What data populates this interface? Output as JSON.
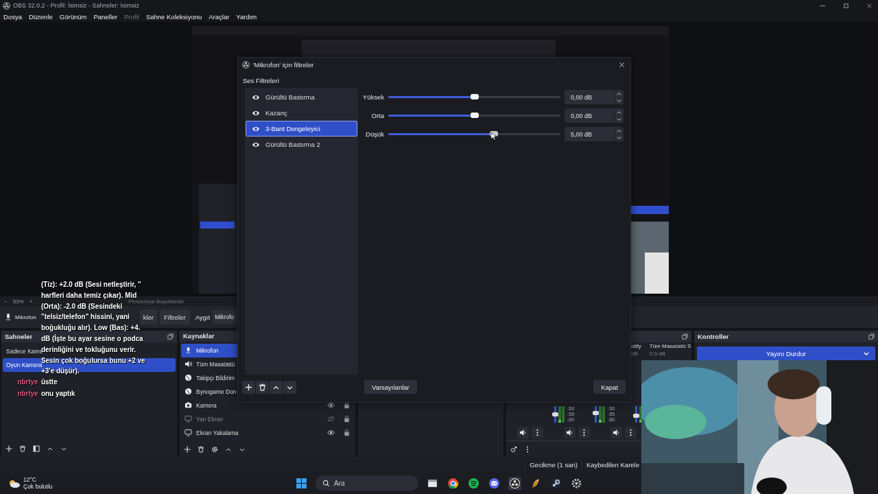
{
  "window": {
    "title": "OBS 32.0.2 - Profil: İsimsiz - Sahneler: İsimsiz"
  },
  "menu": [
    {
      "label": "Dosya",
      "disabled": false
    },
    {
      "label": "Düzenle",
      "disabled": false
    },
    {
      "label": "Görünüm",
      "disabled": false
    },
    {
      "label": "Paneller",
      "disabled": false
    },
    {
      "label": "Profil",
      "disabled": true
    },
    {
      "label": "Sahne Koleksiyonu",
      "disabled": false
    },
    {
      "label": "Araçlar",
      "disabled": false
    },
    {
      "label": "Yardım",
      "disabled": false
    }
  ],
  "zoom_bar": {
    "zoom_out": "−",
    "value": "53%",
    "zoom_in": "+",
    "fit": "Pencereye Boyutlandır"
  },
  "source_toolbar": {
    "source": "Mikrofon",
    "properties": "kler",
    "filters": "Filtreler",
    "device_label": "Aygıt",
    "device": "Mikrofo"
  },
  "scenes": {
    "title": "Sahneler",
    "items": [
      {
        "name": "Sadece Kame",
        "selected": false
      },
      {
        "name": "Oyun Kamera",
        "selected": true
      }
    ]
  },
  "sources": {
    "title": "Kaynaklar",
    "items": [
      {
        "kind": "mic",
        "name": "Mikrofon",
        "selected": true
      },
      {
        "kind": "speaker",
        "name": "Tüm Masaüstü",
        "selected": false
      },
      {
        "kind": "globe",
        "name": "Takipçi Bildirim",
        "selected": false
      },
      {
        "kind": "globe",
        "name": "Bynogame Don",
        "selected": false
      },
      {
        "kind": "camera",
        "name": "Kamera",
        "selected": false,
        "visible": true
      },
      {
        "kind": "monitor",
        "name": "Yan Ekran",
        "selected": false,
        "visible": false
      },
      {
        "kind": "monitor",
        "name": "Ekran Yakalama",
        "selected": false,
        "visible": true
      }
    ]
  },
  "mixer": {
    "channels": [
      {
        "name": "otify",
        "reading": "dB"
      },
      {
        "name": "Tüm Masaüstü S",
        "reading": "0.0 dB"
      }
    ],
    "meters": [
      {
        "scale": [
          "-50",
          "-55",
          "-60"
        ],
        "level": 0.5
      },
      {
        "scale": [
          "-50",
          "-55",
          "-60"
        ],
        "level": 0.6
      },
      {
        "level": 0.4
      }
    ]
  },
  "controls": {
    "title": "Kontroller",
    "button": "Yayını Durdur"
  },
  "status_bar": [
    "Gecikme (1 san)",
    "Kaybedilen Karele"
  ],
  "taskbar": {
    "temperature": "12°C",
    "weather": "Çok bulutlu",
    "search": "Ara"
  },
  "dialog": {
    "title": "'Mikrofon' için filtreler",
    "section": "Ses Filtreleri",
    "filters": [
      {
        "name": "Gürültü Bastırma",
        "selected": false
      },
      {
        "name": "Kazanç",
        "selected": false
      },
      {
        "name": "3-Bant Dengeleyici",
        "selected": true
      },
      {
        "name": "Gürültü Bastırma 2",
        "selected": false
      }
    ],
    "bands": [
      {
        "label": "Yüksek",
        "level": 0.5,
        "reading": "0,00 dB"
      },
      {
        "label": "Orta",
        "level": 0.5,
        "reading": "0,00 dB"
      },
      {
        "label": "Düşük",
        "level": 0.615,
        "reading": "5,00 dB"
      }
    ],
    "defaults": "Varsayılanlar",
    "close": "Kapat"
  },
  "chat": {
    "lines": [
      "(Tiz): +2.0 dB (Sesi netleştirir, \"",
      "harfleri daha temiz çıkar). Mid",
      "(Orta): -2.0 dB (Sesindeki",
      "\"telsiz/telefon\" hissini, yani",
      "boğukluğu alır). Low (Bas): +4.",
      "dB (İşte bu ayar sesine o podca",
      "derinliğini ve tokluğunu verir.",
      "Sesin çok boğulursa bunu +2 ve",
      "+3'e düşür)."
    ],
    "messages": [
      {
        "user": "nbrtye",
        "text": "üstte"
      },
      {
        "user": "nbrtye",
        "text": "onu yaptık"
      }
    ]
  }
}
